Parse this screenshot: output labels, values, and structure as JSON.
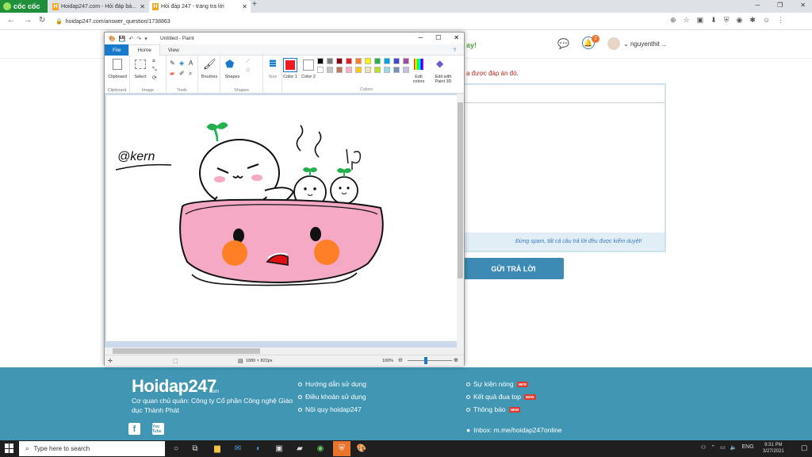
{
  "browser": {
    "brand": "cốc cốc",
    "tabs": [
      {
        "label": "Hoidap247.com - Hỏi đáp bà..."
      },
      {
        "label": "Hỏi đáp 247 - trang tra lời"
      }
    ],
    "url": "hoidap247.com/answer_question/1738863"
  },
  "site": {
    "header_fragment": "ay!",
    "notification_count": "2",
    "username": "nguyenthit ...",
    "answer_note": "ạ được đáp án đó.",
    "spam_note": "Đừng spam, tất cả câu trả lời đều được kiểm duyệt!",
    "submit_label": "GỬI TRẢ LỜI"
  },
  "paint": {
    "title": "Untitled - Paint",
    "menu": [
      "File",
      "Home",
      "View"
    ],
    "groups": {
      "clipboard": "Clipboard",
      "image": "Image",
      "tools": "Tools",
      "shapes": "Shapes",
      "colors": "Colors"
    },
    "tools": {
      "clipboard": "Clipboard",
      "select": "Select",
      "brushes": "Brushes",
      "shapes": "Shapes",
      "size": "Size",
      "color1": "Color 1",
      "color2": "Color 2",
      "edit_colors": "Edit colors",
      "paint3d": "Edit with Paint 3D"
    },
    "palette": [
      "#000000",
      "#7f7f7f",
      "#880015",
      "#ed1c24",
      "#ff7f27",
      "#fff200",
      "#22b14c",
      "#00a2e8",
      "#3f48cc",
      "#a349a4",
      "#ffffff",
      "#c3c3c3",
      "#b97a57",
      "#ffaec9",
      "#ffc90e",
      "#efe4b0",
      "#b5e61d",
      "#99d9ea",
      "#7092be",
      "#c8bfe7"
    ],
    "primary_color": "#ed1c24",
    "canvas_size": "1880 × 822px",
    "zoom": "100%",
    "drawing_text": "@kern"
  },
  "footer": {
    "logo": "Hoidap247",
    "logo_suffix": ".com",
    "company": "Cơ quan chủ quản: Công ty Cổ phần Công nghệ Giáo dục Thành Phát",
    "links_col1": [
      "Hướng dẫn sử dụng",
      "Điều khoản sử dụng",
      "Nội quy hoidap247"
    ],
    "links_col2": [
      "Sự kiện nóng",
      "Kết quả đua top",
      "Thông báo"
    ],
    "new_tag": "NEW",
    "inbox": "Inbox: m.me/hoidap247online",
    "yt": "You Tube"
  },
  "taskbar": {
    "search_placeholder": "Type here to search",
    "lang": "ENG",
    "time": "9:31 PM",
    "date": "3/27/2021"
  }
}
